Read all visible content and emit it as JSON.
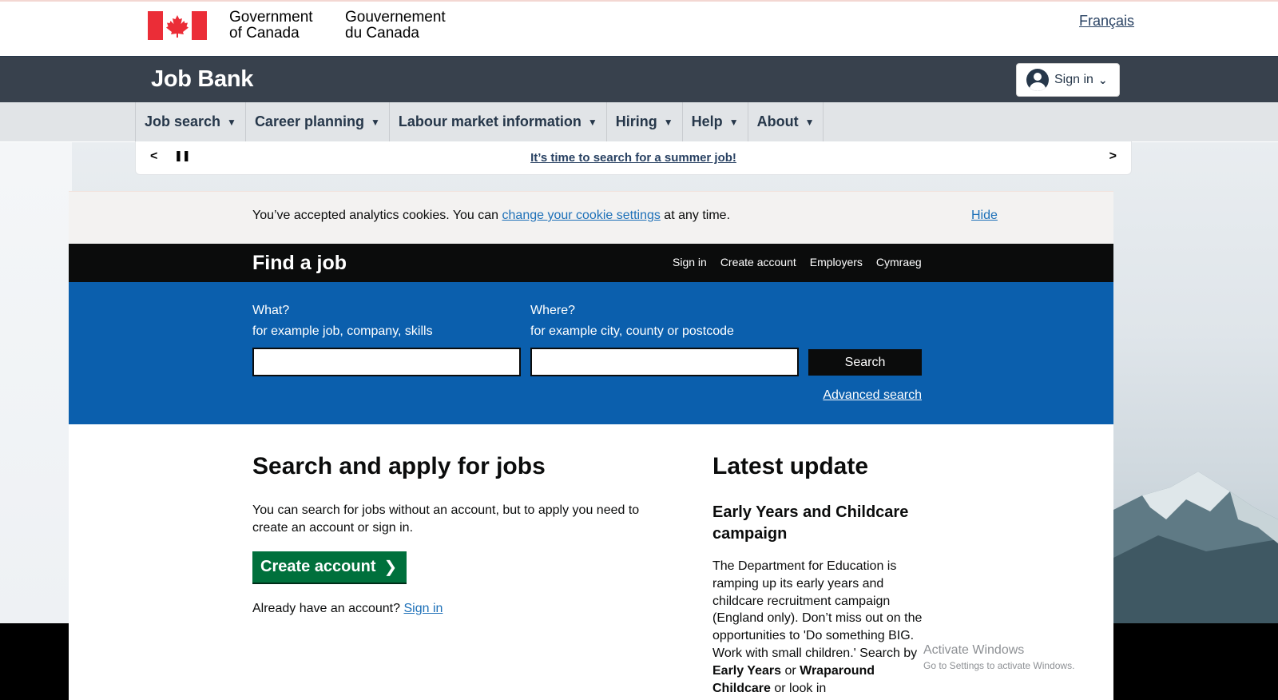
{
  "gc_header": {
    "wordmark_en_line1": "Government",
    "wordmark_en_line2": "of Canada",
    "wordmark_fr_line1": "Gouvernement",
    "wordmark_fr_line2": "du Canada",
    "language_link": "Français"
  },
  "job_bank": {
    "title": "Job Bank",
    "sign_in_label": "Sign in"
  },
  "main_nav": {
    "items": [
      {
        "label": "Job search"
      },
      {
        "label": "Career planning"
      },
      {
        "label": "Labour market information"
      },
      {
        "label": "Hiring"
      },
      {
        "label": "Help"
      },
      {
        "label": "About"
      }
    ]
  },
  "carousel": {
    "message": "It’s time to search for a summer job!"
  },
  "cookie_banner": {
    "text_before": "You’ve accepted analytics cookies. You can ",
    "link": "change your cookie settings",
    "text_after": " at any time.",
    "hide_label": "Hide"
  },
  "find_a_job": {
    "title": "Find a job",
    "links": [
      "Sign in",
      "Create account",
      "Employers",
      "Cymraeg"
    ]
  },
  "search": {
    "what_label": "What?",
    "what_hint": "for example job, company, skills",
    "what_value": "",
    "where_label": "Where?",
    "where_hint": "for example city, county or postcode",
    "where_value": "",
    "button_label": "Search",
    "advanced_link": "Advanced search"
  },
  "left_column": {
    "heading": "Search and apply for jobs",
    "body": "You can search for jobs without an account, but to apply you need to create an account or sign in.",
    "create_button": "Create account",
    "already_text": "Already have an account? ",
    "sign_in_link": "Sign in"
  },
  "right_column": {
    "heading": "Latest update",
    "subheading": "Early Years and Childcare campaign",
    "body_1": "The Department for Education is ramping up its early years and childcare recruitment campaign (England only). Don’t miss out on the opportunities to 'Do something BIG. Work with small children.' Search by ",
    "bold_1": "Early Years",
    "body_2": " or ",
    "bold_2": "Wraparound Childcare",
    "body_3": " or look in"
  },
  "os_watermark": {
    "line1": "Activate Windows",
    "line2": "Go to Settings to activate Windows."
  },
  "colors": {
    "gc_red": "#eb2d37",
    "jobbank_bar": "#38414d",
    "nav_bg": "#e1e4e7",
    "govuk_blue": "#0b5fad",
    "govuk_black": "#0b0c0c",
    "govuk_green": "#00703c",
    "link_blue": "#1d70b8"
  },
  "icons": {
    "flag": "canada-flag-icon",
    "user": "user-icon",
    "dropdown": "chevron-down-icon",
    "prev": "chevron-left-icon",
    "pause": "pause-icon",
    "next": "chevron-right-icon",
    "arrow": "chevron-right-icon"
  }
}
